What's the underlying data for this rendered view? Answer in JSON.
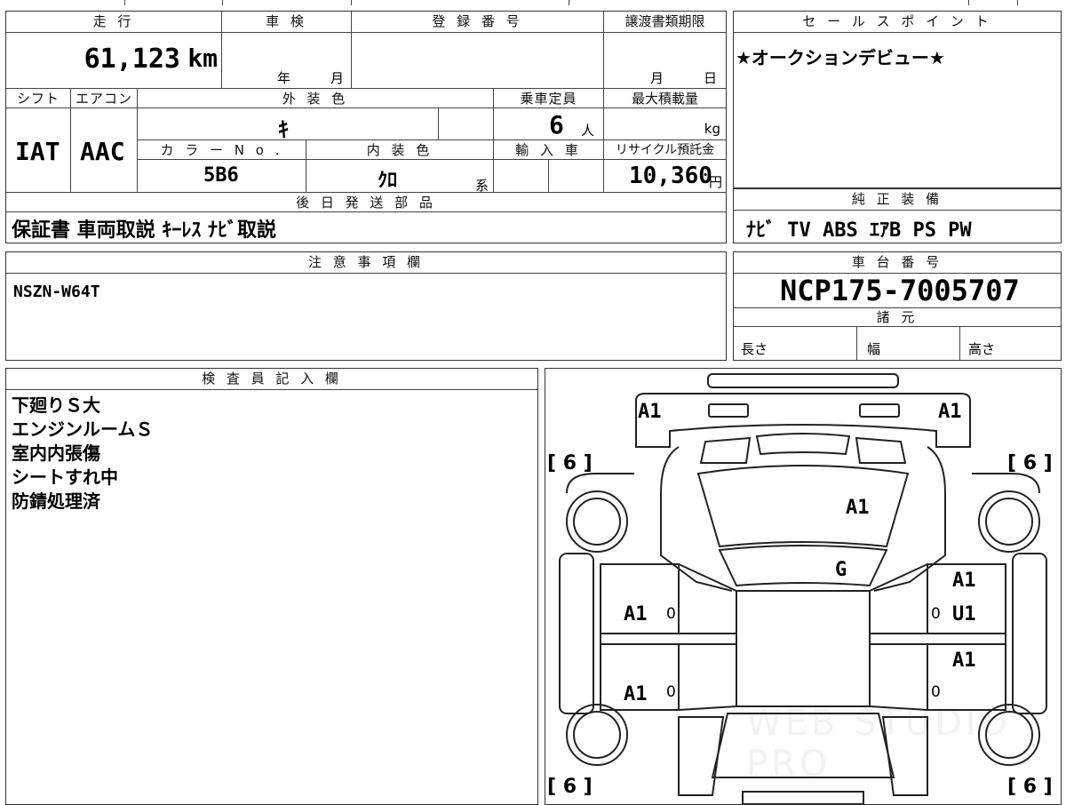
{
  "top_table": {
    "mileage_header": "走 行",
    "mileage_value": "61,123",
    "mileage_unit": "km",
    "inspection_header": "車 検",
    "inspection_year": "年",
    "inspection_month": "月",
    "registration_header": "登 録 番 号",
    "transfer_header": "譲渡書類期限",
    "transfer_month": "月",
    "transfer_day": "日",
    "shift_header": "シフト",
    "shift_value": "IAT",
    "aircon_header": "エアコン",
    "aircon_value": "AAC",
    "exterior_header": "外 装 色",
    "exterior_value": "ｷ",
    "capacity_header": "乗車定員",
    "capacity_value": "6",
    "capacity_unit": "人",
    "maxload_header": "最大積載量",
    "maxload_unit": "kg",
    "color_no_header": "カ ラ ー N o .",
    "color_no_value": "5B6",
    "interior_header": "内 装 色",
    "interior_value": "ｸﾛ",
    "interior_suffix": "系",
    "import_header": "輸 入 車",
    "recycle_header": "リサイクル預託金",
    "recycle_value": "10,360",
    "recycle_unit": "円",
    "later_header": "後 日 発 送 部 品",
    "later_value": "保証書 車両取説 ｷｰﾚｽ ﾅﾋﾞ取説"
  },
  "sales_point": {
    "header": "セ ー ル ス ポ イ ン ト",
    "text": "★オークションデビュー★"
  },
  "genuine_equipment": {
    "header": "純 正 装 備",
    "text": "ﾅﾋﾞ TV ABS ｴｱB PS PW"
  },
  "notes": {
    "header": "注 意 事 項 欄",
    "text": "NSZN-W64T"
  },
  "chassis": {
    "header": "車 台 番 号",
    "value": "NCP175-7005707",
    "spec_header": "諸 元",
    "length": "長さ",
    "width": "幅",
    "height": "高さ"
  },
  "inspector": {
    "header": "検 査 員 記 入 欄",
    "lines": [
      "下廻りＳ大",
      "エンジンルームＳ",
      "室内内張傷",
      "シートすれ中",
      "防錆処理済"
    ]
  },
  "diagram": {
    "marks": {
      "front_left_corner": "A1",
      "front_right_corner": "A1",
      "hood": "A1",
      "windshield": "G",
      "left_front_door": "A1",
      "left_rear_door": "A1",
      "right_front_fender": "A1",
      "right_front_door": "U1",
      "right_rear_door": "A1"
    },
    "tire_marks": [
      "[ 6 ]",
      "[ 6 ]",
      "[ 6 ]",
      "[ 6 ]"
    ],
    "door_zeros": [
      "0",
      "0",
      "0",
      "0"
    ],
    "watermark": "WEB STUDIO PRO"
  }
}
